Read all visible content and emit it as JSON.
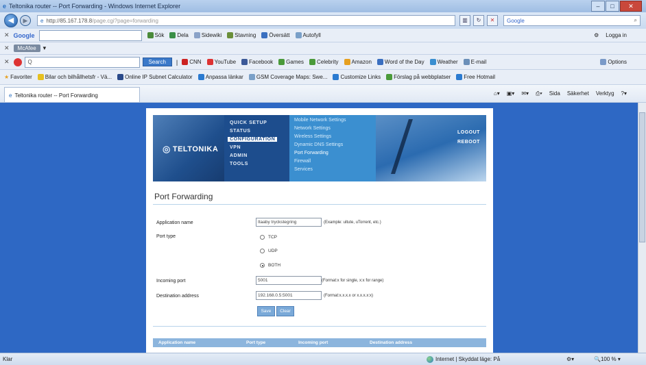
{
  "window": {
    "title": "Teltonika router -- Port Forwarding - Windows Internet Explorer",
    "controls": [
      "–",
      "□",
      "✕"
    ]
  },
  "address_bar": {
    "url": "http://85.167.178.8",
    "url_path": "/page.cgi?page=forwarding",
    "search_engine": "Google",
    "search_icon": "search-icon"
  },
  "google_toolbar": {
    "brand": "Google",
    "items": [
      "Sök",
      "Dela",
      "Sidewiki",
      "Stavning",
      "Översätt",
      "Autofyll"
    ],
    "right": "Logga in"
  },
  "mcafee_toolbar": {
    "label": "McAfee"
  },
  "search_toolbar": {
    "search_placeholder": "Q",
    "search_button": "Search",
    "items": [
      "CNN",
      "YouTube",
      "Facebook",
      "Games",
      "Celebrity",
      "Amazon",
      "Word of the Day",
      "Weather",
      "E-mail"
    ],
    "options": "Options"
  },
  "favorites_bar": {
    "favorites_label": "Favoriter",
    "items": [
      "Bilar och bilhållhetsfr - Vä...",
      "Online IP Subnet Calculator",
      "Anpassa länkar",
      "GSM Coverage Maps: Swe...",
      "Customize Links",
      "Förslag på webbplatser",
      "Free Hotmail"
    ]
  },
  "tab": {
    "title": "Teltonika router -- Port Forwarding"
  },
  "command_bar": {
    "items": [
      "Sida",
      "Säkerhet",
      "Verktyg"
    ]
  },
  "router": {
    "logo": "TELTONIKA",
    "nav": [
      "QUICK SETUP",
      "STATUS",
      "CONFIGURATION",
      "VPN",
      "ADMIN",
      "TOOLS"
    ],
    "active_nav": "CONFIGURATION",
    "subnav": [
      "Mobile Network Settings",
      "Network Settings",
      "Wireless Settings",
      "Dynamic DNS Settings",
      "Port Forwarding",
      "Firewall",
      "Services"
    ],
    "active_subnav": "Port Forwarding",
    "logout": "LOGOUT",
    "reboot": "REBOOT"
  },
  "form": {
    "title": "Port Forwarding",
    "app_name_label": "Application name",
    "app_name_value": "Itaaby tryckstegring",
    "app_name_hint": "(Example: ultute, uTorrent, etc.)",
    "port_type_label": "Port type",
    "options": [
      "TCP",
      "UDP",
      "BOTH"
    ],
    "selected_option": "BOTH",
    "incoming_port_label": "Incoming port",
    "incoming_port_value": "5001",
    "incoming_port_hint": "(Format:x for single, x:x for range)",
    "destination_label": "Destination address",
    "destination_value": "192.168.0.5:5001",
    "destination_hint": "(Format:x.x.x.x or x.x.x.x:x)",
    "save": "Save",
    "clear": "Clear"
  },
  "table": {
    "columns": [
      "Application name",
      "Port type",
      "Incoming port",
      "Destination address"
    ]
  },
  "status_bar": {
    "left": "Klar",
    "zone": "Internet | Skyddat läge: På",
    "zoom": "100 %"
  }
}
